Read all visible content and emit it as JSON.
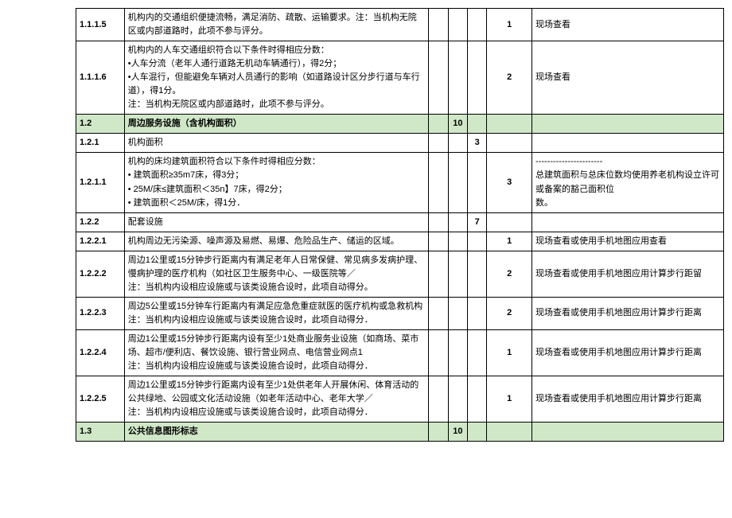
{
  "rows": [
    {
      "id": "1.1.1.5",
      "desc": "机构内的交通组织便捷流畅，满足消防、疏散、运输要求。注：当机构无院区或内部道路时，此项不参与评分。",
      "s4": "1",
      "remark": "现场查看"
    },
    {
      "id": "1.1.1.6",
      "desc": "机构内的人车交通组织符合以下条件时得相应分数：\n•人车分流（老年人通行道路无机动车辆通行），得2分；\n•人车混行，但能避免车辆对人员通行的影响（如道路设计区分步行道与车行道），得1分。\n注：当机构无院区或内部道路时，此项不参与评分。",
      "s4": "2",
      "remark": "现场查看"
    },
    {
      "id": "1.2",
      "desc": "周边服务设施（含机构面积）",
      "s2": "10",
      "header": true
    },
    {
      "id": "1.2.1",
      "desc": "机构面积",
      "s3": "3"
    },
    {
      "id": "1.2.1.1",
      "desc": "机构的床均建筑面积符合以下条件时得相应分数：\n• 建筑面积≥35m7床，得3分；\n• 25M/床≤建筑面积＜35n】7床，得2分；\n• 建筑面积＜25M/床，得1分．",
      "s4": "3",
      "remark": "-----------------------\n总建筑面积与总床位数均使用养老机构设立许可或备案的豁己面积位\n数。"
    },
    {
      "id": "1.2.2",
      "desc": "配套设施",
      "s3": "7"
    },
    {
      "id": "1.2.2.1",
      "desc": "机构周边无污染源、噪声源及易燃、易爆、危险品生产、储运的区域。",
      "s4": "1",
      "remark": "现场查看或使用手机地图应用查看"
    },
    {
      "id": "1.2.2.2",
      "desc": "周边1公里或15分钟步行距离内有满足老年人日常保健、常见病多发病护理、慢病护理的医疗机构（如社区卫生服务中心、一级医院等／\n注：当机构内设相应设施或与该类设施合设时，此项自动得分。",
      "s4": "2",
      "remark": "现场查看或使用手机地图应用计算步行距留"
    },
    {
      "id": "1.2.2.3",
      "desc": "周边5公里或15分钟车行距离内有满足应急危重症就医的医疗机构或急救机构 注：当机构内设相应设施或与该类设施合设时，此项自动得分．",
      "s4": "2",
      "remark": "现场查看或使用手机地图应用计算步行距离"
    },
    {
      "id": "1.2.2.4",
      "desc": "周边1公里或15分钟步行距离内设有至少1处商业服务业设施（如商场、菜市场、超市/便利店、餐饮设施、银行营业网点、电信营业网点1\n注：当机构内设相应设施或与该类设施合设时，此项自动得分．",
      "s4": "1",
      "remark": "现场查看或使用手机地图应用计算步行距离"
    },
    {
      "id": "1.2.2.5",
      "desc": "周边1公里或15分钟步行距离内设有至少1处供老年人开展休闲、体育活动的公共绿地、公园或文化活动设施（如老年活动中心、老年大学／\n注：当机构内设相应设施或与该类设施合设时，此项自动得分．",
      "s4": "1",
      "remark": "现场查看或使用手机地图应用计算步行距离"
    },
    {
      "id": "1.3",
      "desc": "公共信息图形标志",
      "s2": "10",
      "header": true
    }
  ]
}
